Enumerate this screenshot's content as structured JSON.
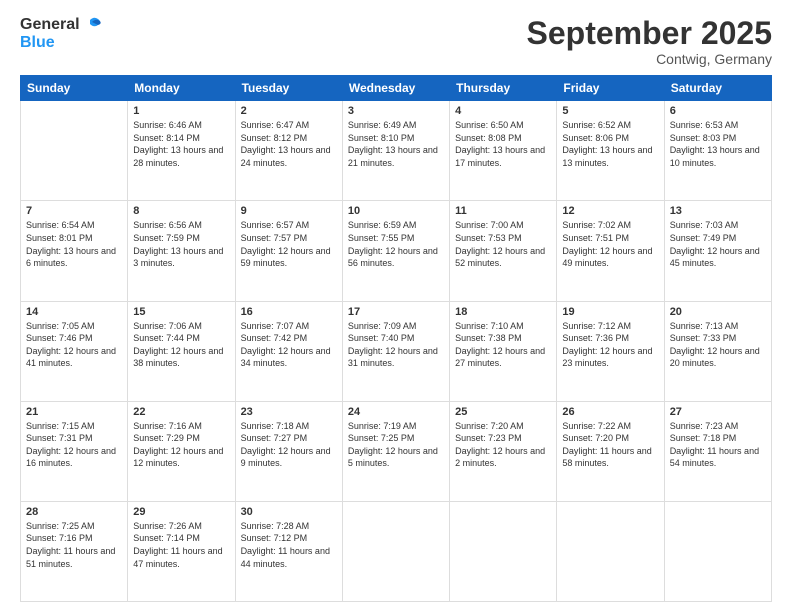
{
  "logo": {
    "line1": "General",
    "line2": "Blue"
  },
  "title": "September 2025",
  "location": "Contwig, Germany",
  "header_days": [
    "Sunday",
    "Monday",
    "Tuesday",
    "Wednesday",
    "Thursday",
    "Friday",
    "Saturday"
  ],
  "weeks": [
    [
      {
        "day": "",
        "sunrise": "",
        "sunset": "",
        "daylight": ""
      },
      {
        "day": "1",
        "sunrise": "Sunrise: 6:46 AM",
        "sunset": "Sunset: 8:14 PM",
        "daylight": "Daylight: 13 hours and 28 minutes."
      },
      {
        "day": "2",
        "sunrise": "Sunrise: 6:47 AM",
        "sunset": "Sunset: 8:12 PM",
        "daylight": "Daylight: 13 hours and 24 minutes."
      },
      {
        "day": "3",
        "sunrise": "Sunrise: 6:49 AM",
        "sunset": "Sunset: 8:10 PM",
        "daylight": "Daylight: 13 hours and 21 minutes."
      },
      {
        "day": "4",
        "sunrise": "Sunrise: 6:50 AM",
        "sunset": "Sunset: 8:08 PM",
        "daylight": "Daylight: 13 hours and 17 minutes."
      },
      {
        "day": "5",
        "sunrise": "Sunrise: 6:52 AM",
        "sunset": "Sunset: 8:06 PM",
        "daylight": "Daylight: 13 hours and 13 minutes."
      },
      {
        "day": "6",
        "sunrise": "Sunrise: 6:53 AM",
        "sunset": "Sunset: 8:03 PM",
        "daylight": "Daylight: 13 hours and 10 minutes."
      }
    ],
    [
      {
        "day": "7",
        "sunrise": "Sunrise: 6:54 AM",
        "sunset": "Sunset: 8:01 PM",
        "daylight": "Daylight: 13 hours and 6 minutes."
      },
      {
        "day": "8",
        "sunrise": "Sunrise: 6:56 AM",
        "sunset": "Sunset: 7:59 PM",
        "daylight": "Daylight: 13 hours and 3 minutes."
      },
      {
        "day": "9",
        "sunrise": "Sunrise: 6:57 AM",
        "sunset": "Sunset: 7:57 PM",
        "daylight": "Daylight: 12 hours and 59 minutes."
      },
      {
        "day": "10",
        "sunrise": "Sunrise: 6:59 AM",
        "sunset": "Sunset: 7:55 PM",
        "daylight": "Daylight: 12 hours and 56 minutes."
      },
      {
        "day": "11",
        "sunrise": "Sunrise: 7:00 AM",
        "sunset": "Sunset: 7:53 PM",
        "daylight": "Daylight: 12 hours and 52 minutes."
      },
      {
        "day": "12",
        "sunrise": "Sunrise: 7:02 AM",
        "sunset": "Sunset: 7:51 PM",
        "daylight": "Daylight: 12 hours and 49 minutes."
      },
      {
        "day": "13",
        "sunrise": "Sunrise: 7:03 AM",
        "sunset": "Sunset: 7:49 PM",
        "daylight": "Daylight: 12 hours and 45 minutes."
      }
    ],
    [
      {
        "day": "14",
        "sunrise": "Sunrise: 7:05 AM",
        "sunset": "Sunset: 7:46 PM",
        "daylight": "Daylight: 12 hours and 41 minutes."
      },
      {
        "day": "15",
        "sunrise": "Sunrise: 7:06 AM",
        "sunset": "Sunset: 7:44 PM",
        "daylight": "Daylight: 12 hours and 38 minutes."
      },
      {
        "day": "16",
        "sunrise": "Sunrise: 7:07 AM",
        "sunset": "Sunset: 7:42 PM",
        "daylight": "Daylight: 12 hours and 34 minutes."
      },
      {
        "day": "17",
        "sunrise": "Sunrise: 7:09 AM",
        "sunset": "Sunset: 7:40 PM",
        "daylight": "Daylight: 12 hours and 31 minutes."
      },
      {
        "day": "18",
        "sunrise": "Sunrise: 7:10 AM",
        "sunset": "Sunset: 7:38 PM",
        "daylight": "Daylight: 12 hours and 27 minutes."
      },
      {
        "day": "19",
        "sunrise": "Sunrise: 7:12 AM",
        "sunset": "Sunset: 7:36 PM",
        "daylight": "Daylight: 12 hours and 23 minutes."
      },
      {
        "day": "20",
        "sunrise": "Sunrise: 7:13 AM",
        "sunset": "Sunset: 7:33 PM",
        "daylight": "Daylight: 12 hours and 20 minutes."
      }
    ],
    [
      {
        "day": "21",
        "sunrise": "Sunrise: 7:15 AM",
        "sunset": "Sunset: 7:31 PM",
        "daylight": "Daylight: 12 hours and 16 minutes."
      },
      {
        "day": "22",
        "sunrise": "Sunrise: 7:16 AM",
        "sunset": "Sunset: 7:29 PM",
        "daylight": "Daylight: 12 hours and 12 minutes."
      },
      {
        "day": "23",
        "sunrise": "Sunrise: 7:18 AM",
        "sunset": "Sunset: 7:27 PM",
        "daylight": "Daylight: 12 hours and 9 minutes."
      },
      {
        "day": "24",
        "sunrise": "Sunrise: 7:19 AM",
        "sunset": "Sunset: 7:25 PM",
        "daylight": "Daylight: 12 hours and 5 minutes."
      },
      {
        "day": "25",
        "sunrise": "Sunrise: 7:20 AM",
        "sunset": "Sunset: 7:23 PM",
        "daylight": "Daylight: 12 hours and 2 minutes."
      },
      {
        "day": "26",
        "sunrise": "Sunrise: 7:22 AM",
        "sunset": "Sunset: 7:20 PM",
        "daylight": "Daylight: 11 hours and 58 minutes."
      },
      {
        "day": "27",
        "sunrise": "Sunrise: 7:23 AM",
        "sunset": "Sunset: 7:18 PM",
        "daylight": "Daylight: 11 hours and 54 minutes."
      }
    ],
    [
      {
        "day": "28",
        "sunrise": "Sunrise: 7:25 AM",
        "sunset": "Sunset: 7:16 PM",
        "daylight": "Daylight: 11 hours and 51 minutes."
      },
      {
        "day": "29",
        "sunrise": "Sunrise: 7:26 AM",
        "sunset": "Sunset: 7:14 PM",
        "daylight": "Daylight: 11 hours and 47 minutes."
      },
      {
        "day": "30",
        "sunrise": "Sunrise: 7:28 AM",
        "sunset": "Sunset: 7:12 PM",
        "daylight": "Daylight: 11 hours and 44 minutes."
      },
      {
        "day": "",
        "sunrise": "",
        "sunset": "",
        "daylight": ""
      },
      {
        "day": "",
        "sunrise": "",
        "sunset": "",
        "daylight": ""
      },
      {
        "day": "",
        "sunrise": "",
        "sunset": "",
        "daylight": ""
      },
      {
        "day": "",
        "sunrise": "",
        "sunset": "",
        "daylight": ""
      }
    ]
  ]
}
